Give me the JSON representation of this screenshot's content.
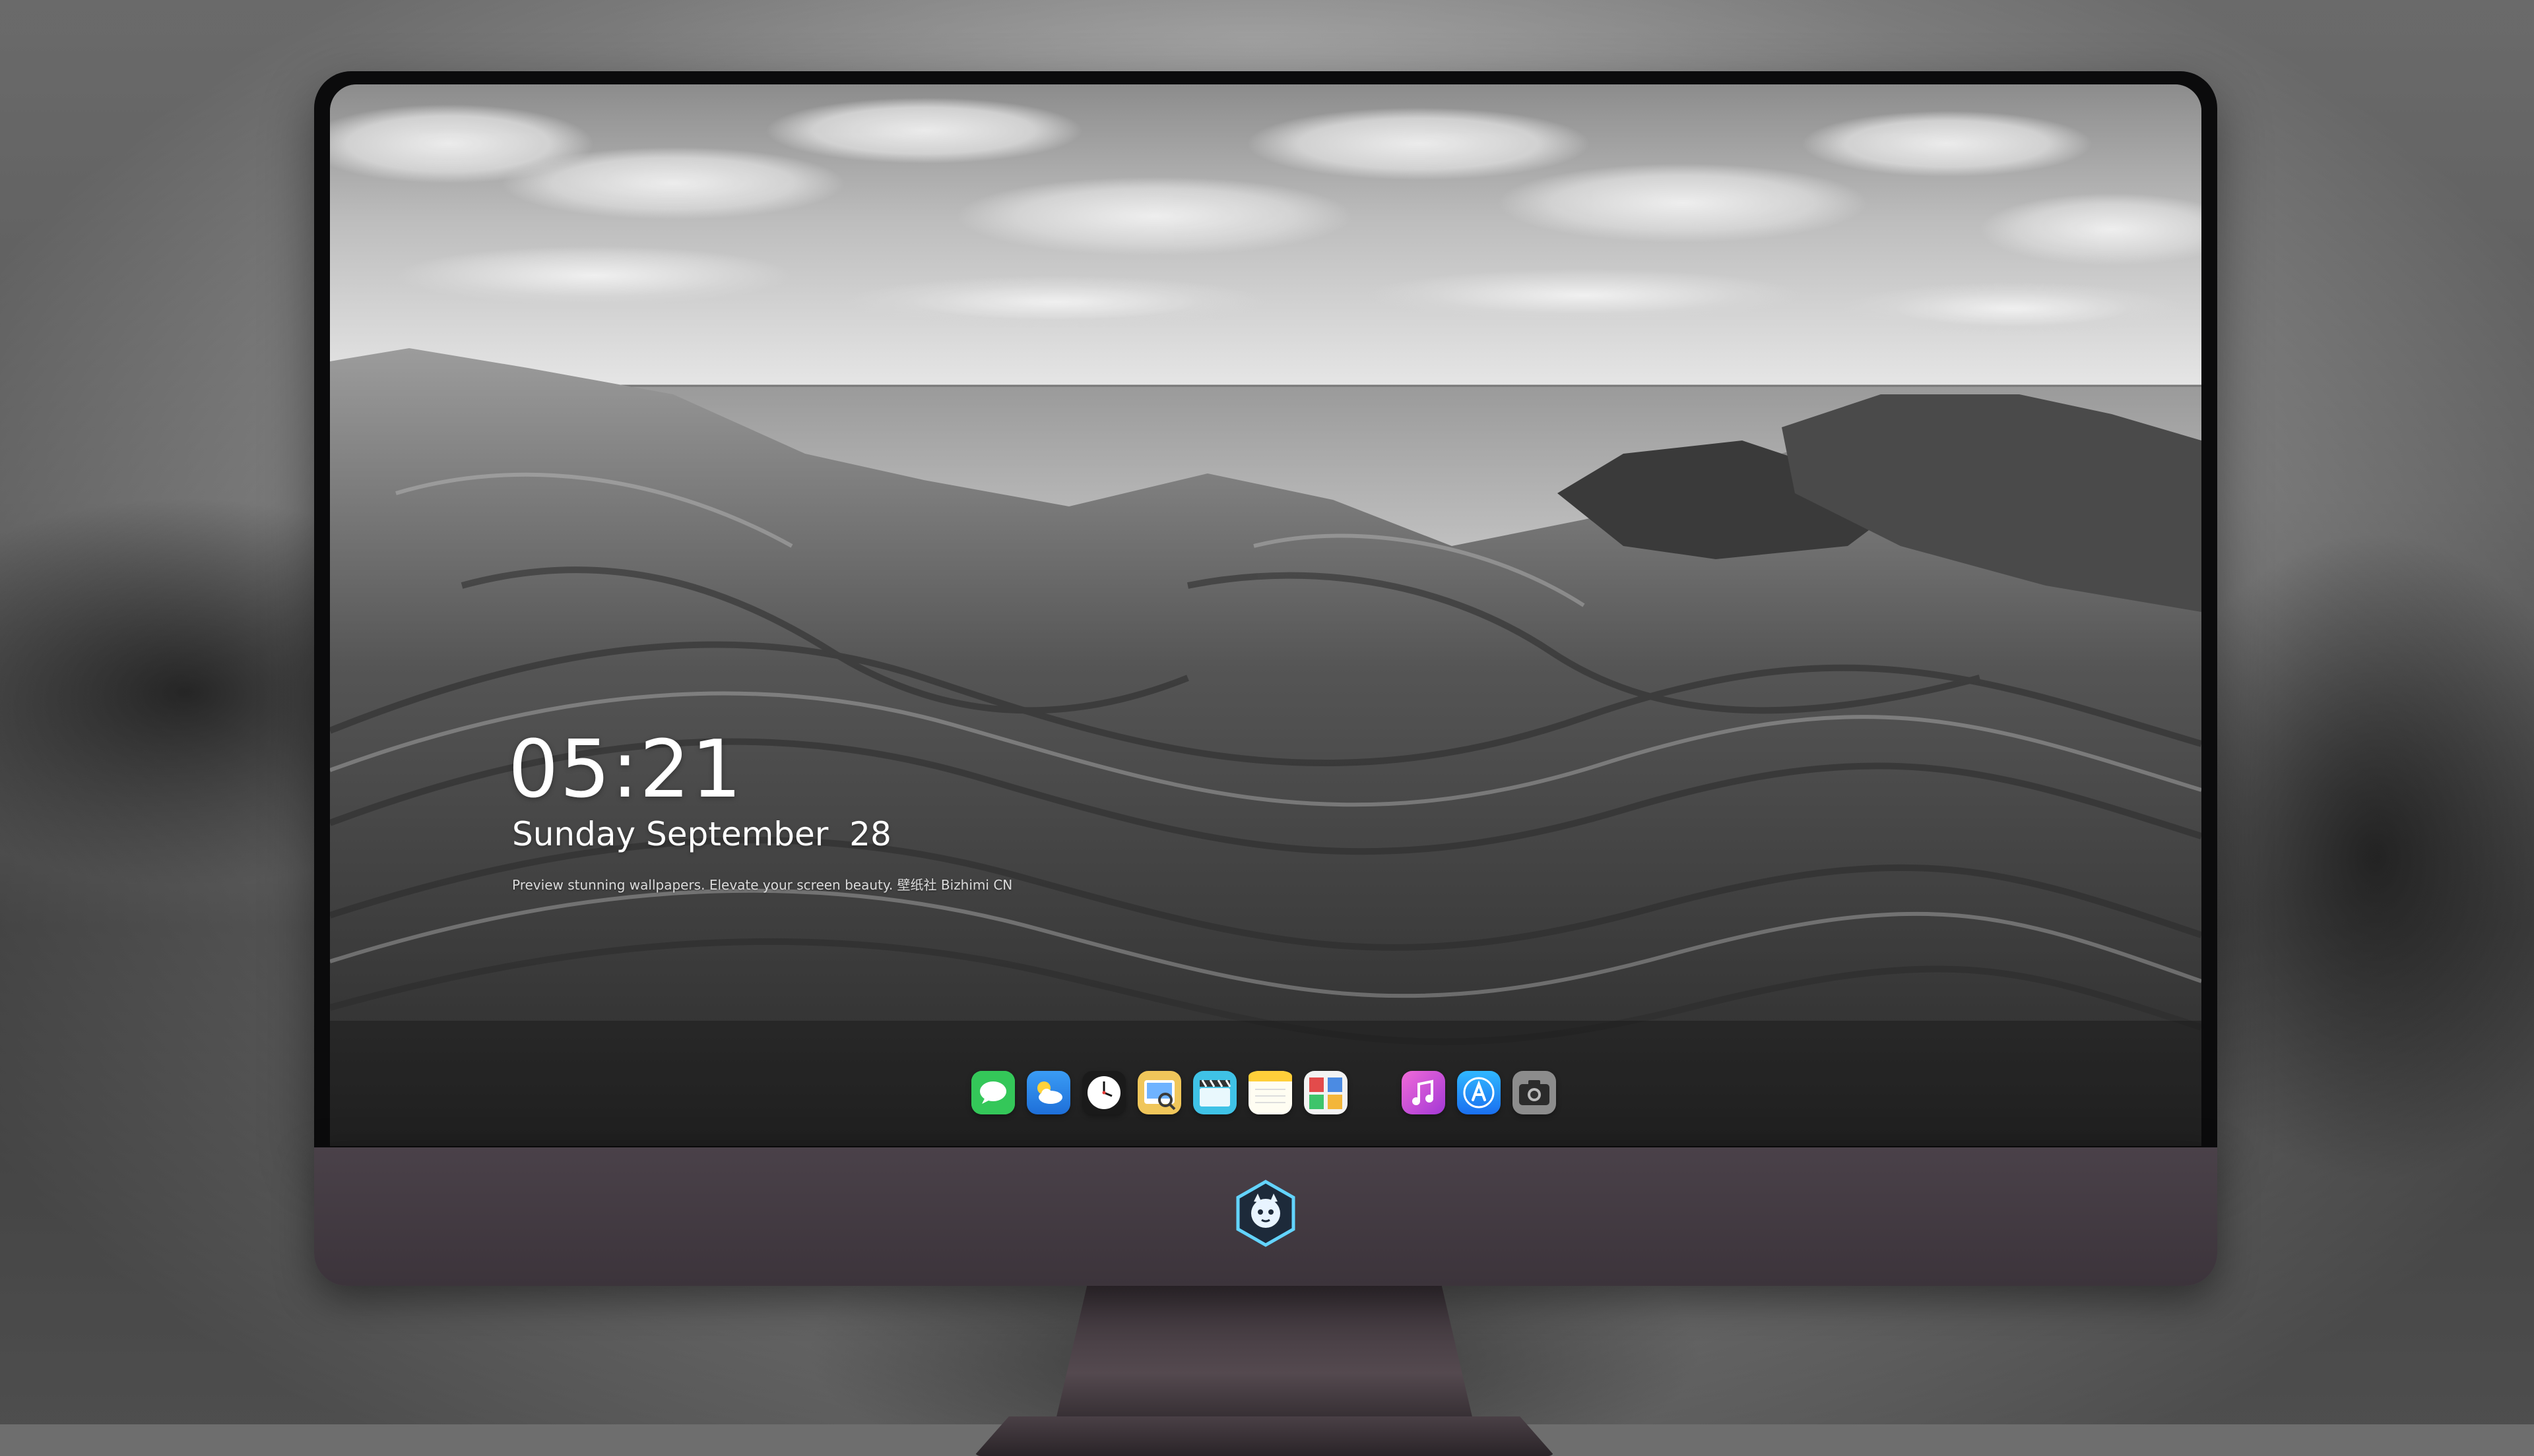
{
  "lockscreen": {
    "time": "05:21",
    "date": "Sunday September  28",
    "tagline": "Preview stunning wallpapers. Elevate your screen beauty. 壁纸社 Bizhimi CN"
  },
  "dock": {
    "apps": [
      {
        "name": "messages",
        "icon": "messages-icon",
        "color": "#34c759"
      },
      {
        "name": "weather",
        "icon": "weather-icon",
        "color": "#2f8ff0"
      },
      {
        "name": "clock",
        "icon": "clock-icon",
        "color": "#ffffff"
      },
      {
        "name": "preview",
        "icon": "preview-icon",
        "color": "#e8c05a"
      },
      {
        "name": "video",
        "icon": "clapperboard-icon",
        "color": "#47c6e6"
      },
      {
        "name": "notes",
        "icon": "notes-icon",
        "color": "#ffd54a"
      },
      {
        "name": "photo-booth",
        "icon": "photo-booth-icon",
        "color": "#e34b4b"
      },
      {
        "name": "music",
        "icon": "music-icon",
        "color": "#d63fd8"
      },
      {
        "name": "app-store",
        "icon": "app-store-icon",
        "color": "#1e88ff"
      },
      {
        "name": "camera",
        "icon": "camera-icon",
        "color": "#8a8a8a"
      }
    ]
  },
  "monitor": {
    "logo": "mascot-logo-icon"
  }
}
